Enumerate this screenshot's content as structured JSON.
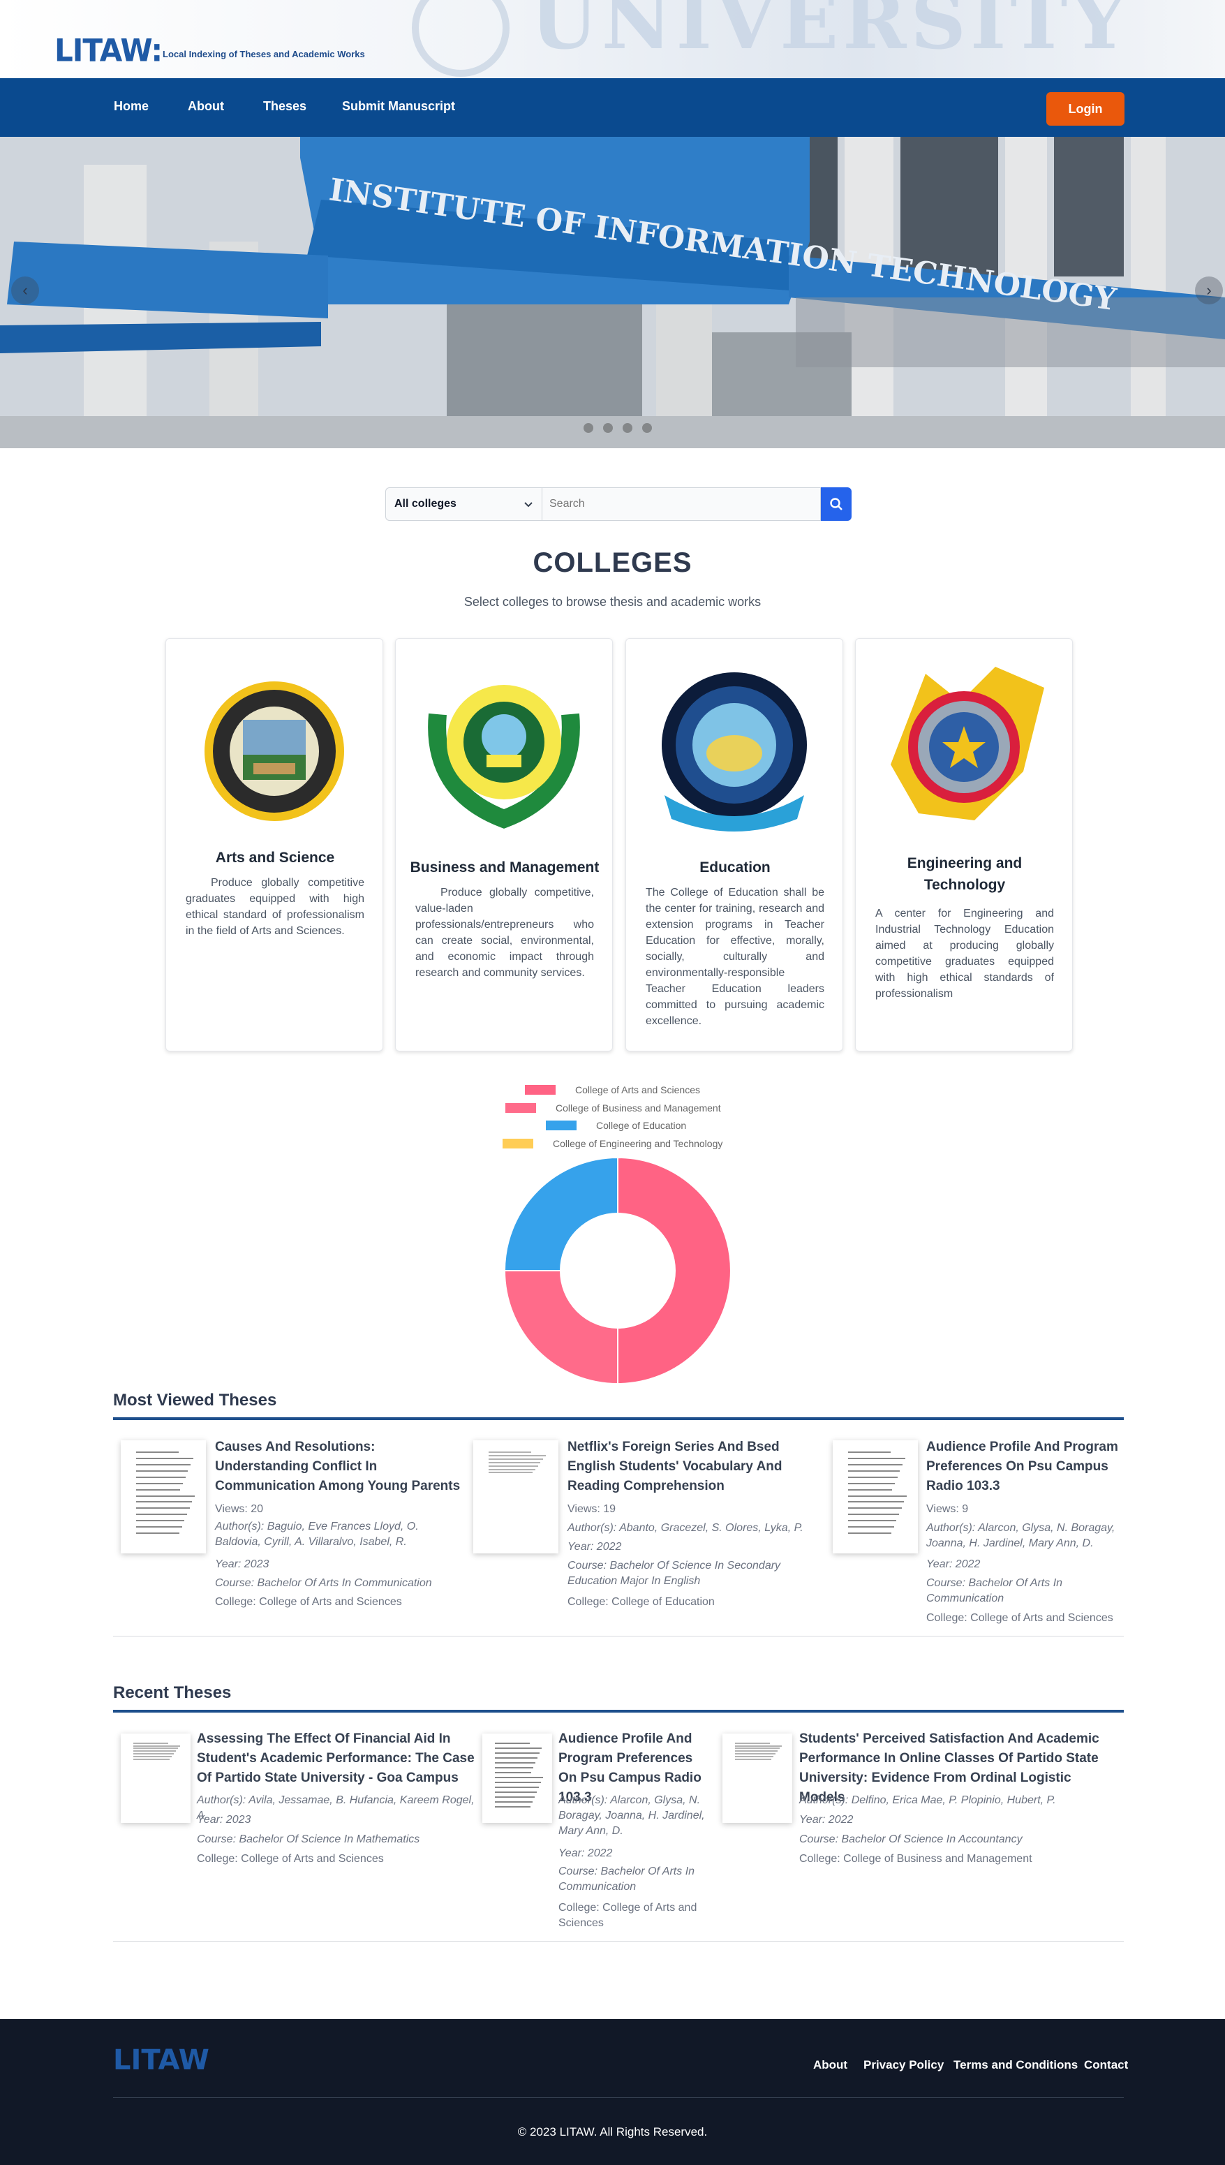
{
  "brand": {
    "logo_text": "LITAW:",
    "tagline": "Local Indexing of Theses and Academic Works",
    "banner_text": "UNIVERSITY"
  },
  "nav": {
    "items": [
      "Home",
      "About",
      "Theses",
      "Submit Manuscript"
    ],
    "login_label": "Login"
  },
  "hero": {
    "sign_text": "INSTITUTE OF INFORMATION TECHNOLOGY",
    "prev_icon": "chevron-left-icon",
    "next_icon": "chevron-right-icon"
  },
  "search": {
    "college_selected": "All colleges",
    "placeholder": "Search",
    "button_icon": "search-icon"
  },
  "colleges": {
    "title": "COLLEGES",
    "subtitle": "Select colleges to browse thesis and academic works",
    "cards": [
      {
        "name": "Arts and Science",
        "description": "Produce globally competitive graduates equipped with high ethical standard of professionalism in the field of Arts and Sciences."
      },
      {
        "name": "Business and Management",
        "description": "Produce globally competitive, value-laden professionals/entrepreneurs who can create social, environmental, and economic impact through research and community services."
      },
      {
        "name": "Education",
        "description": "The College of Education shall be the center for training, research and extension programs in Teacher Education for effective, morally, socially, culturally and environmentally-responsible Teacher Education leaders committed to pursuing academic excellence."
      },
      {
        "name": "Engineering and Technology",
        "description": "A center for Engineering and Industrial Technology Education aimed at producing globally competitive graduates equipped with high ethical standards of professionalism"
      }
    ]
  },
  "chart_data": {
    "type": "doughnut",
    "categories": [
      "College of Arts and Sciences",
      "College of Business and Management",
      "College of Education",
      "College of Engineering and Technology"
    ],
    "values": [
      2,
      1,
      1,
      0
    ],
    "colors": [
      "#ff6384",
      "#ff6b8a",
      "#36a2eb",
      "#ffcd56"
    ],
    "legend": "top"
  },
  "most_viewed": {
    "title": "Most Viewed Theses",
    "items": [
      {
        "title": "Causes And Resolutions: Understanding Conflict In Communication Among Young Parents",
        "views": "Views: 20",
        "authors": "Author(s): Baguio, Eve Frances Lloyd, O. Baldovia, Cyrill, A. Villaralvo, Isabel, R.",
        "year": "Year: 2023",
        "course": "Course: Bachelor Of Arts In Communication",
        "college": "College: College of Arts and Sciences"
      },
      {
        "title": "Netflix's Foreign Series And Bsed English Students' Vocabulary And Reading Comprehension",
        "views": "Views: 19",
        "authors": "Author(s): Abanto, Gracezel, S. Olores, Lyka, P.",
        "year": "Year: 2022",
        "course": "Course: Bachelor Of Science In Secondary Education Major In English",
        "college": "College: College of Education"
      },
      {
        "title": "Audience Profile And Program Preferences On Psu Campus Radio 103.3",
        "views": "Views: 9",
        "authors": "Author(s): Alarcon, Glysa, N. Boragay, Joanna, H. Jardinel, Mary Ann, D.",
        "year": "Year: 2022",
        "course": "Course: Bachelor Of Arts In Communication",
        "college": "College: College of Arts and Sciences"
      }
    ]
  },
  "recent": {
    "title": "Recent Theses",
    "items": [
      {
        "title": "Assessing The Effect Of Financial Aid In Student's Academic Performance: The Case Of Partido State University - Goa Campus",
        "authors": "Author(s): Avila, Jessamae, B. Hufancia, Kareem Rogel, A.",
        "year": "Year: 2023",
        "course": "Course: Bachelor Of Science In Mathematics",
        "college": "College: College of Arts and Sciences"
      },
      {
        "title": "Audience Profile And Program Preferences On Psu Campus Radio 103.3",
        "authors": "Author(s): Alarcon, Glysa, N. Boragay, Joanna, H. Jardinel, Mary Ann, D.",
        "year": "Year: 2022",
        "course": "Course: Bachelor Of Arts In Communication",
        "college": "College: College of Arts and Sciences"
      },
      {
        "title": "Students' Perceived Satisfaction And Academic Performance In Online Classes Of Partido State University: Evidence From Ordinal Logistic Models",
        "authors": "Author(s): Delfino, Erica Mae, P. Plopinio, Hubert, P.",
        "year": "Year: 2022",
        "course": "Course: Bachelor Of Science In Accountancy",
        "college": "College: College of Business and Management"
      }
    ]
  },
  "footer": {
    "logo_text": "LITAW",
    "links": [
      "About",
      "Privacy Policy",
      "Terms and Conditions",
      "Contact"
    ],
    "copyright": "© 2023 LITAW. All Rights Reserved."
  }
}
